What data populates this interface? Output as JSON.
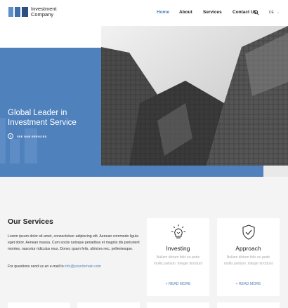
{
  "header": {
    "logo_line1": "Investment",
    "logo_line2": "Company",
    "nav": [
      "Home",
      "About",
      "Services",
      "Contact Us"
    ],
    "active_nav": "Home",
    "search_icon": "search-icon",
    "language": "DE"
  },
  "hero": {
    "title": "Global Leader in Investment Service",
    "cta_label": "SEE OUR SERVICES",
    "accent_color": "#4f81bd"
  },
  "services": {
    "title": "Our Services",
    "body": "Lorem ipsum dolor sit amet, consectetuer adipiscing elit. Aenean commodo ligula eget dolor. Aenean massa. Cum sociis natoque penatibus et magnis dis parturient montes, nascetur ridiculus mus. Donec quam felis, ultricies nec, pellentesque.",
    "contact_prefix": "For questions send us an e-mail to ",
    "contact_email": "info@yourdomain.com",
    "cards": [
      {
        "icon": "lightbulb-icon",
        "title": "Investing",
        "description": "Nullam dictum felis eu pede mollis pretium. Integer tincidunt",
        "more": "+ READ MORE"
      },
      {
        "icon": "shield-check-icon",
        "title": "Approach",
        "description": "Nullam dictum felis eu pede mollis pretium. Integer tincidunt",
        "more": "+ READ MORE"
      }
    ]
  }
}
